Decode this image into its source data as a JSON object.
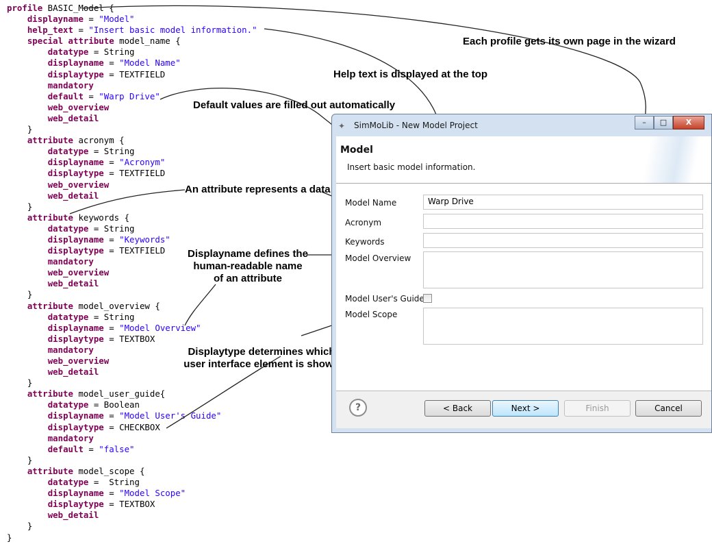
{
  "code_lines": [
    [
      [
        "kw",
        "profile"
      ],
      [
        "t",
        " BASIC_Model {"
      ]
    ],
    [
      [
        "t",
        "    "
      ],
      [
        "kw",
        "displayname"
      ],
      [
        "t",
        " = "
      ],
      [
        "str",
        "\"Model\""
      ]
    ],
    [
      [
        "t",
        "    "
      ],
      [
        "kw",
        "help_text"
      ],
      [
        "t",
        " = "
      ],
      [
        "str",
        "\"Insert basic model information.\""
      ]
    ],
    [
      [
        "t",
        "    "
      ],
      [
        "kw",
        "special attribute"
      ],
      [
        "t",
        " model_name {"
      ]
    ],
    [
      [
        "t",
        "        "
      ],
      [
        "kw",
        "datatype"
      ],
      [
        "t",
        " = String"
      ]
    ],
    [
      [
        "t",
        "        "
      ],
      [
        "kw",
        "displayname"
      ],
      [
        "t",
        " = "
      ],
      [
        "str",
        "\"Model Name\""
      ]
    ],
    [
      [
        "t",
        "        "
      ],
      [
        "kw",
        "displaytype"
      ],
      [
        "t",
        " = TEXTFIELD"
      ]
    ],
    [
      [
        "t",
        "        "
      ],
      [
        "kw",
        "mandatory"
      ]
    ],
    [
      [
        "t",
        "        "
      ],
      [
        "kw",
        "default"
      ],
      [
        "t",
        " = "
      ],
      [
        "str",
        "\"Warp Drive\""
      ]
    ],
    [
      [
        "t",
        "        "
      ],
      [
        "kw",
        "web_overview"
      ]
    ],
    [
      [
        "t",
        "        "
      ],
      [
        "kw",
        "web_detail"
      ]
    ],
    [
      [
        "t",
        "    }"
      ]
    ],
    [
      [
        "t",
        "    "
      ],
      [
        "kw",
        "attribute"
      ],
      [
        "t",
        " acronym {"
      ]
    ],
    [
      [
        "t",
        "        "
      ],
      [
        "kw",
        "datatype"
      ],
      [
        "t",
        " = String"
      ]
    ],
    [
      [
        "t",
        "        "
      ],
      [
        "kw",
        "displayname"
      ],
      [
        "t",
        " = "
      ],
      [
        "str",
        "\"Acronym\""
      ]
    ],
    [
      [
        "t",
        "        "
      ],
      [
        "kw",
        "displaytype"
      ],
      [
        "t",
        " = TEXTFIELD"
      ]
    ],
    [
      [
        "t",
        "        "
      ],
      [
        "kw",
        "web_overview"
      ]
    ],
    [
      [
        "t",
        "        "
      ],
      [
        "kw",
        "web_detail"
      ]
    ],
    [
      [
        "t",
        "    }"
      ]
    ],
    [
      [
        "t",
        "    "
      ],
      [
        "kw",
        "attribute"
      ],
      [
        "t",
        " keywords {"
      ]
    ],
    [
      [
        "t",
        "        "
      ],
      [
        "kw",
        "datatype"
      ],
      [
        "t",
        " = String"
      ]
    ],
    [
      [
        "t",
        "        "
      ],
      [
        "kw",
        "displayname"
      ],
      [
        "t",
        " = "
      ],
      [
        "str",
        "\"Keywords\""
      ]
    ],
    [
      [
        "t",
        "        "
      ],
      [
        "kw",
        "displaytype"
      ],
      [
        "t",
        " = TEXTFIELD"
      ]
    ],
    [
      [
        "t",
        "        "
      ],
      [
        "kw",
        "mandatory"
      ]
    ],
    [
      [
        "t",
        "        "
      ],
      [
        "kw",
        "web_overview"
      ]
    ],
    [
      [
        "t",
        "        "
      ],
      [
        "kw",
        "web_detail"
      ]
    ],
    [
      [
        "t",
        "    }"
      ]
    ],
    [
      [
        "t",
        "    "
      ],
      [
        "kw",
        "attribute"
      ],
      [
        "t",
        " model_overview {"
      ]
    ],
    [
      [
        "t",
        "        "
      ],
      [
        "kw",
        "datatype"
      ],
      [
        "t",
        " = String"
      ]
    ],
    [
      [
        "t",
        "        "
      ],
      [
        "kw",
        "displayname"
      ],
      [
        "t",
        " = "
      ],
      [
        "str",
        "\"Model Overview\""
      ]
    ],
    [
      [
        "t",
        "        "
      ],
      [
        "kw",
        "displaytype"
      ],
      [
        "t",
        " = TEXTBOX"
      ]
    ],
    [
      [
        "t",
        "        "
      ],
      [
        "kw",
        "mandatory"
      ]
    ],
    [
      [
        "t",
        "        "
      ],
      [
        "kw",
        "web_overview"
      ]
    ],
    [
      [
        "t",
        "        "
      ],
      [
        "kw",
        "web_detail"
      ]
    ],
    [
      [
        "t",
        "    }"
      ]
    ],
    [
      [
        "t",
        "    "
      ],
      [
        "kw",
        "attribute"
      ],
      [
        "t",
        " model_user_guide{"
      ]
    ],
    [
      [
        "t",
        "        "
      ],
      [
        "kw",
        "datatype"
      ],
      [
        "t",
        " = Boolean"
      ]
    ],
    [
      [
        "t",
        "        "
      ],
      [
        "kw",
        "displayname"
      ],
      [
        "t",
        " = "
      ],
      [
        "str",
        "\"Model User's Guide\""
      ]
    ],
    [
      [
        "t",
        "        "
      ],
      [
        "kw",
        "displaytype"
      ],
      [
        "t",
        " = CHECKBOX"
      ]
    ],
    [
      [
        "t",
        "        "
      ],
      [
        "kw",
        "mandatory"
      ]
    ],
    [
      [
        "t",
        "        "
      ],
      [
        "kw",
        "default"
      ],
      [
        "t",
        " = "
      ],
      [
        "str",
        "\"false\""
      ]
    ],
    [
      [
        "t",
        "    }"
      ]
    ],
    [
      [
        "t",
        "    "
      ],
      [
        "kw",
        "attribute"
      ],
      [
        "t",
        " model_scope {"
      ]
    ],
    [
      [
        "t",
        "        "
      ],
      [
        "kw",
        "datatype"
      ],
      [
        "t",
        " =  String"
      ]
    ],
    [
      [
        "t",
        "        "
      ],
      [
        "kw",
        "displayname"
      ],
      [
        "t",
        " = "
      ],
      [
        "str",
        "\"Model Scope\""
      ]
    ],
    [
      [
        "t",
        "        "
      ],
      [
        "kw",
        "displaytype"
      ],
      [
        "t",
        " = TEXTBOX"
      ]
    ],
    [
      [
        "t",
        "        "
      ],
      [
        "kw",
        "web_detail"
      ]
    ],
    [
      [
        "t",
        "    }"
      ]
    ],
    [
      [
        "t",
        "}"
      ]
    ]
  ],
  "annotations": {
    "profile_page": "Each profile gets its own page in the wizard",
    "help_text": "Help text is displayed at the top",
    "default_values": "Default values are filled out automatically",
    "attribute": "An attribute represents a data field",
    "displayname_1": "Displayname defines the",
    "displayname_2": "human-readable name",
    "displayname_3": "of an attribute",
    "displaytype_1": "Displaytype determines which",
    "displaytype_2": "user interface element is shown"
  },
  "window": {
    "title": "SimMoLib - New Model Project",
    "minimize_label": "–",
    "maximize_label": "□",
    "close_label": "X",
    "page_title": "Model",
    "page_help": "Insert basic model information.",
    "fields": {
      "model_name_label": "Model Name",
      "model_name_value": "Warp Drive",
      "acronym_label": "Acronym",
      "keywords_label": "Keywords",
      "overview_label": "Model Overview",
      "user_guide_label": "Model User's Guide",
      "user_guide_checked": false,
      "scope_label": "Model Scope"
    },
    "buttons": {
      "help": "?",
      "back": "< Back",
      "next": "Next >",
      "finish": "Finish",
      "cancel": "Cancel"
    }
  },
  "colors": {
    "keyword": "#7f0055",
    "string": "#2a00ff"
  }
}
